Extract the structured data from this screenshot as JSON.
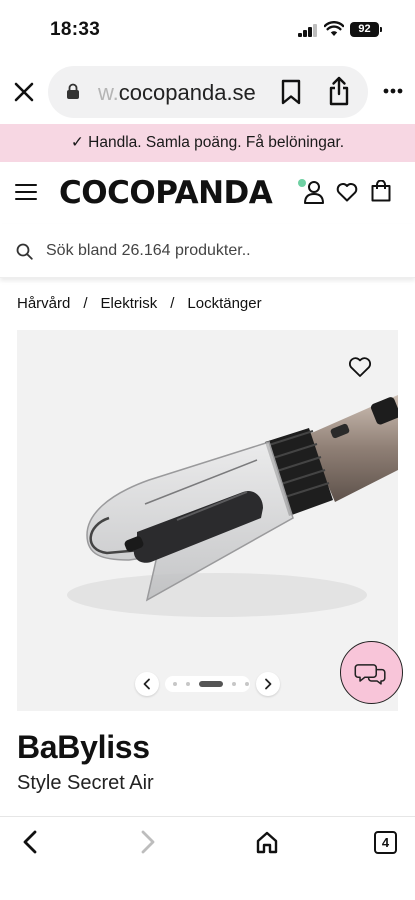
{
  "status_bar": {
    "time": "18:33",
    "battery": "92"
  },
  "browser": {
    "url_faded": "w.",
    "url_main": "cocopanda.se"
  },
  "promo": {
    "text": "✓ Handla. Samla poäng. Få belöningar."
  },
  "header": {
    "logo": "COCOPANDA"
  },
  "search": {
    "placeholder": "Sök bland 26.164 produkter.."
  },
  "breadcrumb": {
    "items": [
      "Hårvård",
      "Elektrisk",
      "Locktänger"
    ],
    "separator": "/"
  },
  "product": {
    "brand": "BaByliss",
    "name": "Style Secret Air",
    "carousel": {
      "slide_count": 5,
      "active_index": 2
    }
  },
  "toolbar": {
    "tab_count": "4"
  },
  "colors": {
    "promo_bg": "#f7d7e3",
    "chat_bg": "#f8c5d9",
    "online_dot": "#6fd0a3"
  }
}
